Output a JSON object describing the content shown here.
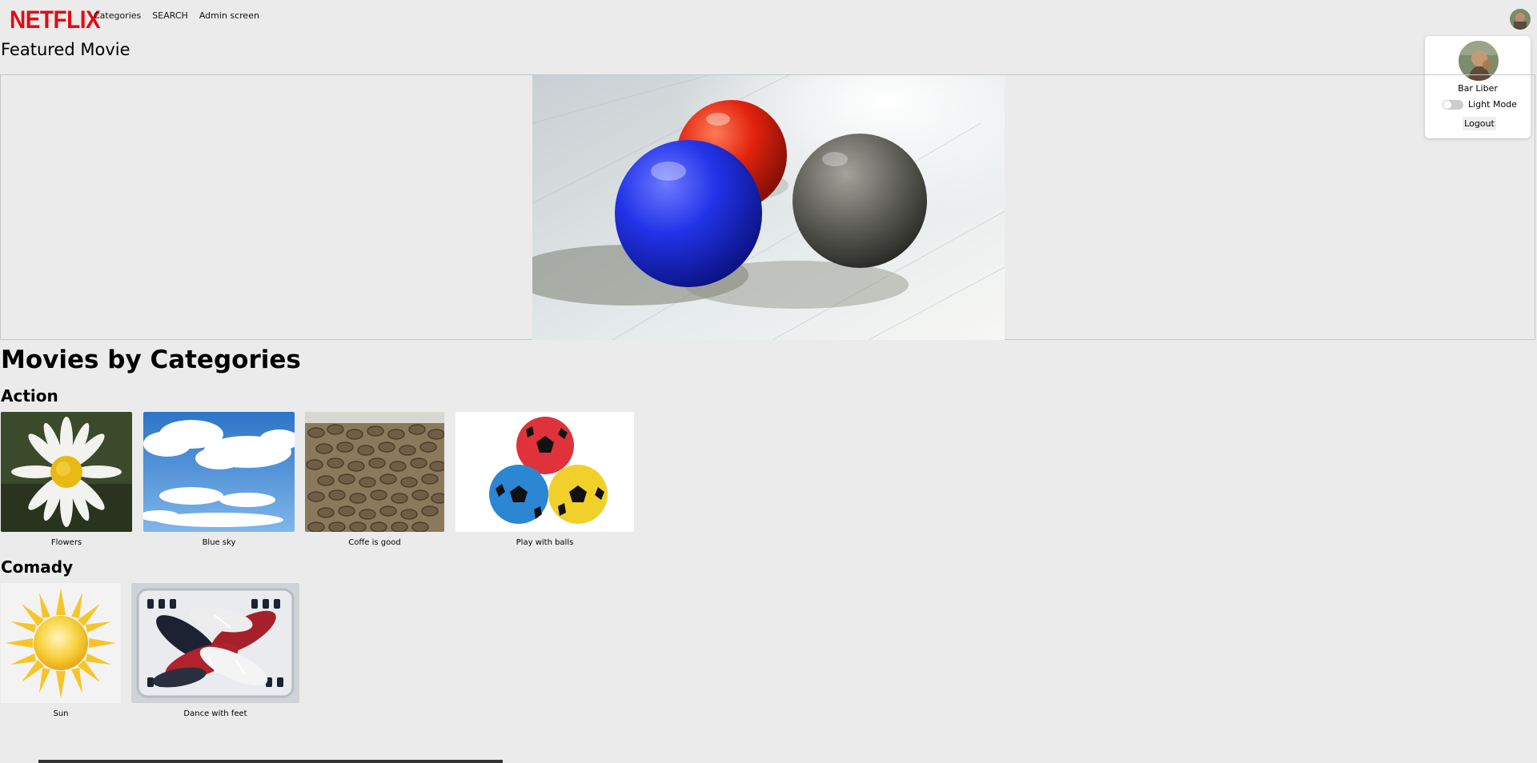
{
  "nav": {
    "logo": "NETFLIX",
    "links": [
      "Categories",
      "SEARCH",
      "Admin screen"
    ]
  },
  "profile": {
    "name": "Bar Liber",
    "mode_label": "Light Mode",
    "mode_on": false,
    "logout_label": "Logout"
  },
  "featured": {
    "title": "Featured Movie"
  },
  "categories_section": {
    "title": "Movies by Categories",
    "categories": [
      {
        "name": "Action",
        "movies": [
          "Flowers",
          "Blue sky",
          "Coffe is good",
          "Play with balls"
        ]
      },
      {
        "name": "Comady",
        "movies": [
          "Sun",
          "Dance with feet"
        ]
      }
    ]
  },
  "colors": {
    "brand": "#e50914",
    "background": "#ebebeb"
  }
}
